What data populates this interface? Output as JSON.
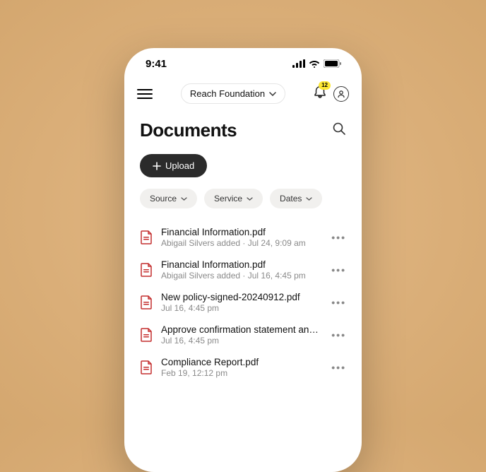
{
  "status": {
    "time": "9:41"
  },
  "topbar": {
    "org_label": "Reach Foundation",
    "notification_count": "12"
  },
  "header": {
    "title": "Documents",
    "upload_label": "Upload"
  },
  "filters": [
    {
      "label": "Source"
    },
    {
      "label": "Service"
    },
    {
      "label": "Dates"
    }
  ],
  "documents": [
    {
      "name": "Financial Information.pdf",
      "meta": "Abigail Silvers added · Jul 24, 9:09 am"
    },
    {
      "name": "Financial Information.pdf",
      "meta": "Abigail Silvers added · Jul 16, 4:45 pm"
    },
    {
      "name": "New policy-signed-20240912.pdf",
      "meta": "Jul 16, 4:45 pm"
    },
    {
      "name": "Approve confirmation statement and sele...",
      "meta": "Jul 16, 4:45 pm"
    },
    {
      "name": "Compliance Report.pdf",
      "meta": "Feb 19, 12:12 pm"
    }
  ]
}
